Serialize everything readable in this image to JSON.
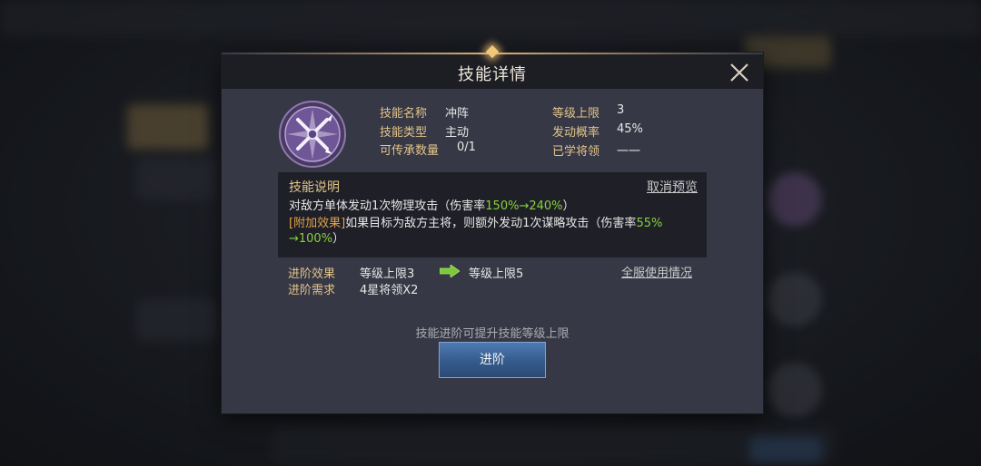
{
  "dialog": {
    "title": "技能详情"
  },
  "skill": {
    "labels": {
      "name": "技能名称",
      "type": "技能类型",
      "inherit": "可传承数量",
      "level_cap": "等级上限",
      "trigger_rate": "发动概率",
      "learned_by": "已学将领"
    },
    "values": {
      "name": "冲阵",
      "type": "主动",
      "inherit": "0/1",
      "level_cap": "3",
      "trigger_rate": "45%",
      "learned_by": "一一"
    },
    "icon": "crossed-swords-icon"
  },
  "description": {
    "title": "技能说明",
    "cancel_preview": "取消预览",
    "line1_text": "对敌方单体发动1次物理攻击（伤害率",
    "line1_green": "150%→240%",
    "line1_end": "）",
    "line2_tag": "[附加效果]",
    "line2_text": "如果目标为敌方主将，则额外发动1次谋略攻击（伤害率",
    "line2_green": "55%",
    "line3_green": "→100%",
    "line3_end": "）"
  },
  "advance": {
    "effect_label": "进阶效果",
    "effect_from": "等级上限3",
    "effect_to": "等级上限5",
    "requirement_label": "进阶需求",
    "requirement_value": "4星将领X2",
    "server_usage": "全服使用情况",
    "hint": "技能进阶可提升技能等级上限",
    "button_label": "进阶"
  },
  "colors": {
    "gold_label": "#e2c48a",
    "green_value": "#86d13c",
    "button_blue": "#345a8c"
  }
}
